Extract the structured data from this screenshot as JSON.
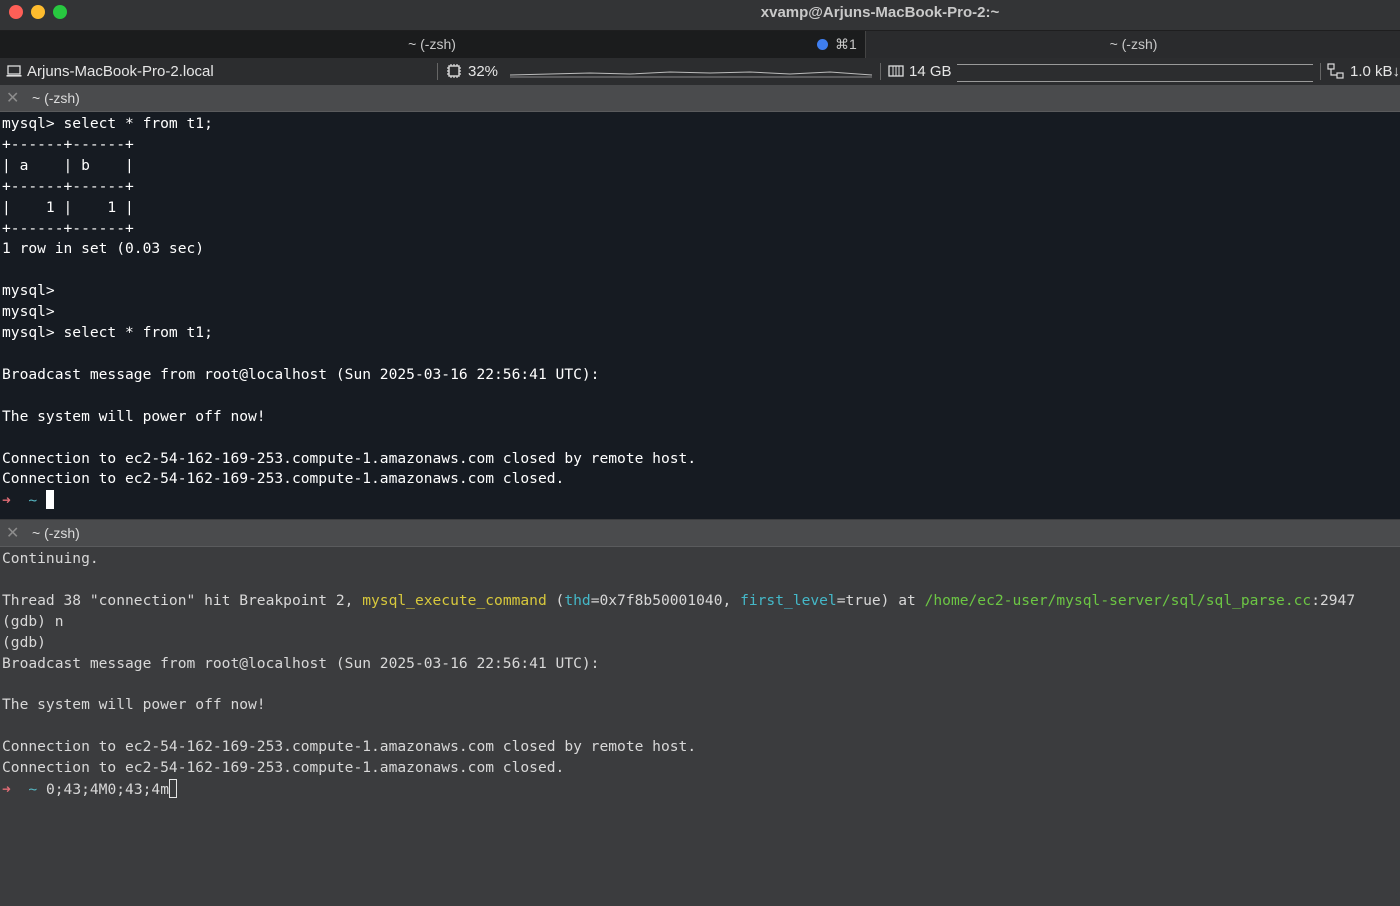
{
  "window": {
    "title": "xvamp@Arjuns-MacBook-Pro-2:~"
  },
  "tabs": [
    {
      "label": "~ (-zsh)",
      "shortcut": "⌘1",
      "active": true
    },
    {
      "label": "~ (-zsh)",
      "active": false
    }
  ],
  "status_bar": {
    "hostname": "Arjuns-MacBook-Pro-2.local",
    "cpu": "32%",
    "memory": "14 GB",
    "network": "1.0 kB↓"
  },
  "panes": [
    {
      "title": "~ (-zsh)",
      "lines": [
        "mysql> select * from t1;",
        "+------+------+",
        "| a    | b    |",
        "+------+------+",
        "|    1 |    1 |",
        "+------+------+",
        "1 row in set (0.03 sec)",
        "",
        "mysql>",
        "mysql>",
        "mysql> select * from t1;",
        "",
        "Broadcast message from root@localhost (Sun 2025-03-16 22:56:41 UTC):",
        "",
        "The system will power off now!",
        "",
        "Connection to ec2-54-162-169-253.compute-1.amazonaws.com closed by remote host.",
        "Connection to ec2-54-162-169-253.compute-1.amazonaws.com closed."
      ],
      "prompt": {
        "arrow": "➜",
        "dir": "~",
        "input": ""
      }
    },
    {
      "title": "~ (-zsh)",
      "lines_before": [
        "Continuing.",
        ""
      ],
      "breakpoint": {
        "prefix": "Thread 38 \"connection\" hit Breakpoint 2, ",
        "function": "mysql_execute_command",
        "arg1_name": "thd",
        "arg1_value": "=0x7f8b50001040, ",
        "arg2_name": "first_level",
        "arg2_value": "=true) at ",
        "file": "/home/ec2-user/mysql-server/sql/sql_parse.cc",
        "line": ":2947"
      },
      "lines_after": [
        "(gdb) n",
        "(gdb)",
        "Broadcast message from root@localhost (Sun 2025-03-16 22:56:41 UTC):",
        "",
        "The system will power off now!",
        "",
        "Connection to ec2-54-162-169-253.compute-1.amazonaws.com closed by remote host.",
        "Connection to ec2-54-162-169-253.compute-1.amazonaws.com closed."
      ],
      "prompt": {
        "arrow": "➜",
        "dir": "~",
        "input": "0;43;4M0;43;4m"
      }
    }
  ]
}
